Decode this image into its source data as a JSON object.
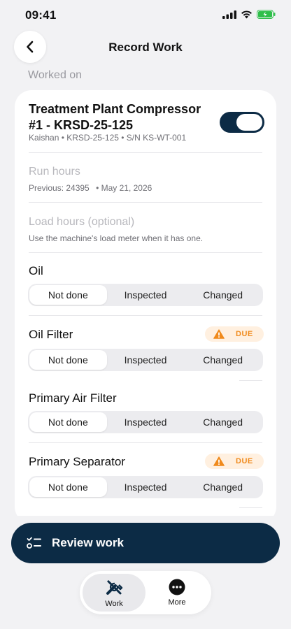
{
  "status": {
    "time": "09:41"
  },
  "nav": {
    "title": "Record Work",
    "back_icon": "chevron-left-icon"
  },
  "section": {
    "label": "Worked on"
  },
  "machine": {
    "name": "Treatment Plant Compressor #1 - KRSD-25-125",
    "meta": "Kaishan • KRSD-25-125 • S/N KS-WT-001",
    "toggle_on": true
  },
  "run_hours": {
    "placeholder": "Run hours",
    "previous": "Previous: 24395",
    "date": "• May 21, 2026"
  },
  "load_hours": {
    "placeholder": "Load hours (optional)",
    "help": "Use the machine's load meter when it has one."
  },
  "segment_options": [
    "Not done",
    "Inspected",
    "Changed"
  ],
  "items": [
    {
      "title": "Oil",
      "due": false,
      "selected": "Not done"
    },
    {
      "title": "Oil Filter",
      "due": true,
      "due_label": "DUE",
      "selected": "Not done"
    },
    {
      "title": "Primary Air Filter",
      "due": false,
      "selected": "Not done"
    },
    {
      "title": "Primary Separator",
      "due": true,
      "due_label": "DUE",
      "selected": "Not done"
    }
  ],
  "review": {
    "label": "Review work",
    "icon": "checklist-icon"
  },
  "tabs": [
    {
      "label": "Work",
      "icon": "tools-icon",
      "active": true
    },
    {
      "label": "More",
      "icon": "more-icon",
      "active": false
    }
  ],
  "colors": {
    "primary": "#0c2b45",
    "due_bg": "#fff0e0",
    "due_fg": "#f08a1c",
    "battery": "#2fbf4a"
  }
}
